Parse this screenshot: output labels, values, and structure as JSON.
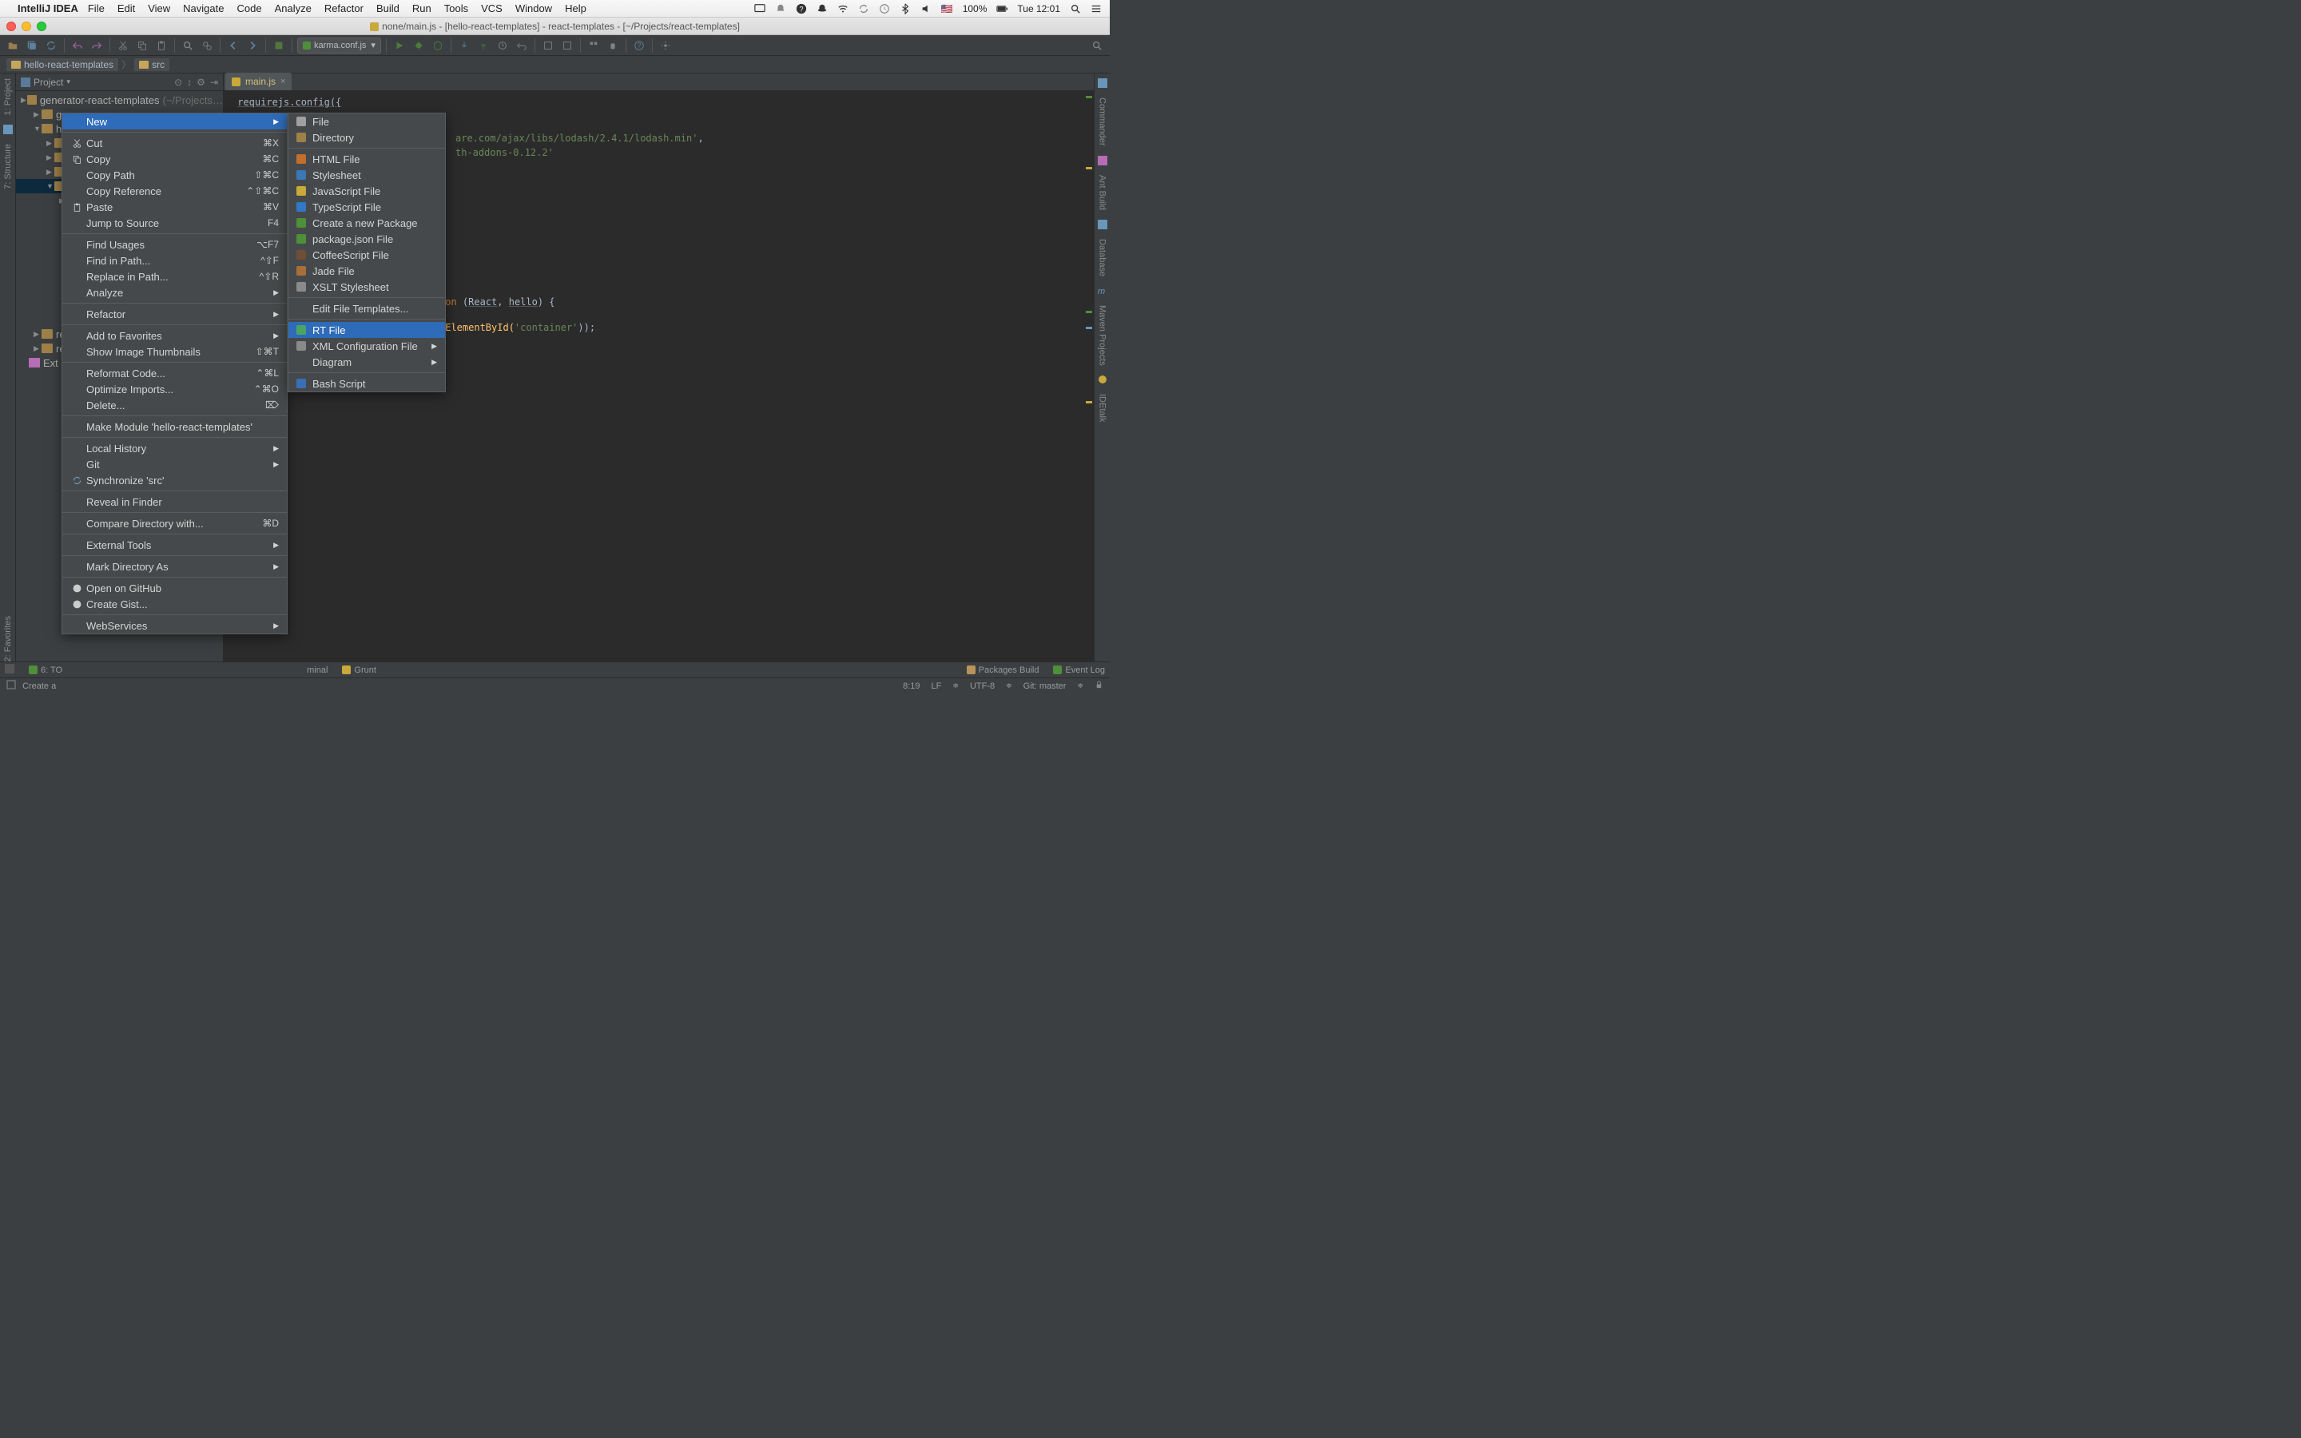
{
  "mac_menu": {
    "app": "IntelliJ IDEA",
    "items": [
      "File",
      "Edit",
      "View",
      "Navigate",
      "Code",
      "Analyze",
      "Refactor",
      "Build",
      "Run",
      "Tools",
      "VCS",
      "Window",
      "Help"
    ],
    "battery": "100%",
    "clock": "Tue 12:01"
  },
  "window_title": "none/main.js - [hello-react-templates] - react-templates - [~/Projects/react-templates]",
  "toolbar": {
    "run_config": "karma.conf.js"
  },
  "breadcrumbs": [
    "hello-react-templates",
    "src"
  ],
  "editor_tab": "main.js",
  "project": {
    "header": "Project",
    "root": {
      "label": "generator-react-templates",
      "hint": "(~/Projects…"
    },
    "nodes": [
      "gru",
      "hel",
      "rea",
      "rea"
    ],
    "ext_lib": "Ext"
  },
  "left_tools": [
    "1: Project",
    "7: Structure"
  ],
  "left_bottom_tool": "2: Favorites",
  "right_tools": [
    "Commander",
    "Ant Build",
    "Database",
    "Maven Projects",
    "IDEtalk"
  ],
  "code": {
    "l1": "requirejs.config({",
    "l2_a": " ",
    "l2_b": "are.com/ajax/libs/lodash/2.4.1/lodash.min'",
    "l2_c": ",",
    "l3_a": " ",
    "l3_b": "th-addons-0.12.2'",
    "l4_a": "ion",
    "l4_b": " (",
    "l4_c": "React",
    "l4_d": ", ",
    "l4_e": "hello",
    "l4_f": ") {",
    "l5_a": "tElementById(",
    "l5_b": "'container'",
    "l5_c": "));"
  },
  "ctx": [
    {
      "label": "New",
      "sel": true,
      "sub": true
    },
    {
      "sep": true
    },
    {
      "label": "Cut",
      "icon": "cut",
      "sc": "⌘X"
    },
    {
      "label": "Copy",
      "icon": "copy",
      "sc": "⌘C"
    },
    {
      "label": "Copy Path",
      "sc": "⇧⌘C"
    },
    {
      "label": "Copy Reference",
      "sc": "⌃⇧⌘C"
    },
    {
      "label": "Paste",
      "icon": "paste",
      "sc": "⌘V"
    },
    {
      "label": "Jump to Source",
      "sc": "F4"
    },
    {
      "sep": true
    },
    {
      "label": "Find Usages",
      "sc": "⌥F7"
    },
    {
      "label": "Find in Path...",
      "sc": "^⇧F"
    },
    {
      "label": "Replace in Path...",
      "sc": "^⇧R"
    },
    {
      "label": "Analyze",
      "sub": true
    },
    {
      "sep": true
    },
    {
      "label": "Refactor",
      "sub": true
    },
    {
      "sep": true
    },
    {
      "label": "Add to Favorites",
      "sub": true
    },
    {
      "label": "Show Image Thumbnails",
      "sc": "⇧⌘T"
    },
    {
      "sep": true
    },
    {
      "label": "Reformat Code...",
      "sc": "⌃⌘L"
    },
    {
      "label": "Optimize Imports...",
      "sc": "⌃⌘O"
    },
    {
      "label": "Delete...",
      "sc": "⌦"
    },
    {
      "sep": true
    },
    {
      "label": "Make Module 'hello-react-templates'"
    },
    {
      "sep": true
    },
    {
      "label": "Local History",
      "sub": true
    },
    {
      "label": "Git",
      "sub": true
    },
    {
      "label": "Synchronize 'src'",
      "icon": "sync"
    },
    {
      "sep": true
    },
    {
      "label": "Reveal in Finder"
    },
    {
      "sep": true
    },
    {
      "label": "Compare Directory with...",
      "sc": "⌘D"
    },
    {
      "sep": true
    },
    {
      "label": "External Tools",
      "sub": true
    },
    {
      "sep": true
    },
    {
      "label": "Mark Directory As",
      "sub": true
    },
    {
      "sep": true
    },
    {
      "label": "Open on GitHub",
      "icon": "gh"
    },
    {
      "label": "Create Gist...",
      "icon": "gh"
    },
    {
      "sep": true
    },
    {
      "label": "WebServices",
      "sub": true
    }
  ],
  "submenu": [
    {
      "label": "File",
      "icon": "#a0a0a0"
    },
    {
      "label": "Directory",
      "icon": "#9e8048"
    },
    {
      "sep": true
    },
    {
      "label": "HTML File",
      "icon": "#c26f2e"
    },
    {
      "label": "Stylesheet",
      "icon": "#3a78b5"
    },
    {
      "label": "JavaScript File",
      "icon": "#c8a93a"
    },
    {
      "label": "TypeScript File",
      "icon": "#3178c6"
    },
    {
      "label": "Create a new Package",
      "icon": "#4e8f3a"
    },
    {
      "label": "package.json File",
      "icon": "#4e8f3a"
    },
    {
      "label": "CoffeeScript File",
      "icon": "#6f4e37"
    },
    {
      "label": "Jade File",
      "icon": "#a86f3a"
    },
    {
      "label": "XSLT Stylesheet",
      "icon": "#8a8a8a"
    },
    {
      "sep": true
    },
    {
      "label": "Edit File Templates..."
    },
    {
      "sep": true
    },
    {
      "label": "RT File",
      "sel": true,
      "icon": "#4aa564"
    },
    {
      "label": "XML Configuration File",
      "sub": true,
      "icon": "#8a8a8a"
    },
    {
      "label": "Diagram",
      "sub": true
    },
    {
      "sep": true
    },
    {
      "label": "Bash Script",
      "icon": "#3a6fb5"
    }
  ],
  "bottom_tabs": {
    "todo": "6: TO",
    "terminal": "minal",
    "grunt": "Grunt",
    "packages": "Packages Build",
    "eventlog": "Event Log"
  },
  "status": {
    "left": "Create a",
    "pos": "8:19",
    "lf": "LF",
    "enc": "UTF-8",
    "git": "Git: master"
  }
}
